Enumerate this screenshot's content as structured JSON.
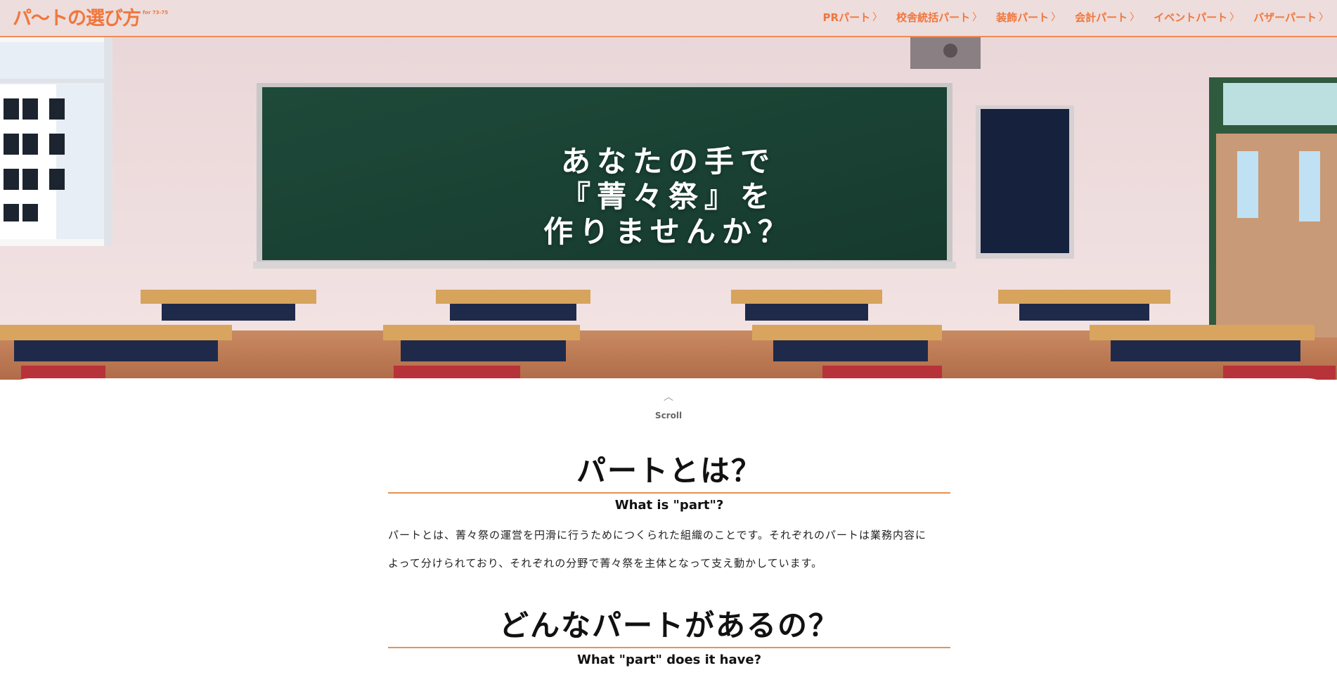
{
  "header": {
    "logo_text": "パ〜トの選び方",
    "logo_sub": "for 73-75",
    "nav": [
      {
        "label": "PRパート",
        "chevron": "〉"
      },
      {
        "label": "校舎統括パート",
        "chevron": "〉"
      },
      {
        "label": "装飾パート",
        "chevron": "〉"
      },
      {
        "label": "会計パート",
        "chevron": "〉"
      },
      {
        "label": "イベントパート",
        "chevron": "〉"
      },
      {
        "label": "バザーパート",
        "chevron": "〉"
      }
    ]
  },
  "hero": {
    "line1": "あなたの手で",
    "line2": "『菁々祭』を",
    "line3": "作りませんか？"
  },
  "scroll": {
    "label": "Scroll"
  },
  "section1": {
    "title": "パートとは？",
    "subtitle": "What is \"part\"?",
    "body1": "パートとは、菁々祭の運営を円滑に行うためにつくられた組織のことです。それぞれのパートは業務内容に",
    "body2": "よって分けられており、それぞれの分野で菁々祭を主体となって支え動かしています。"
  },
  "section2": {
    "title": "どんなパートがあるの？",
    "subtitle": "What \"part\" does it have?"
  },
  "colors": {
    "accent": "#f0773c",
    "rule": "#e8914f"
  }
}
